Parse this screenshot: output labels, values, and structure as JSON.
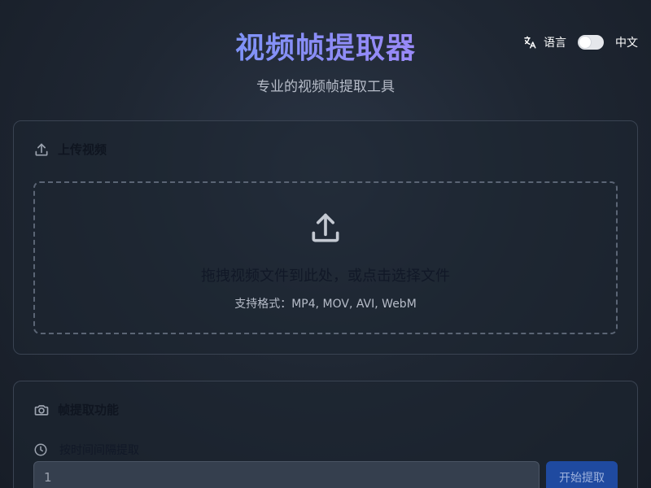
{
  "header": {
    "title": "视频帧提取器",
    "subtitle": "专业的视频帧提取工具"
  },
  "language": {
    "label": "语言",
    "current": "中文",
    "icon": "translate-icon",
    "toggle_on": false
  },
  "upload_card": {
    "title": "上传视频",
    "icon": "upload-icon",
    "dropzone": {
      "icon": "upload-arrow-icon",
      "main_text": "拖拽视频文件到此处，或点击选择文件",
      "formats_text": "支持格式：MP4, MOV, AVI, WebM"
    }
  },
  "extract_card": {
    "title": "帧提取功能",
    "icon": "camera-icon",
    "mode": {
      "label": "按时间间隔提取",
      "icon": "clock-icon"
    },
    "interval_value": "1",
    "start_button": "开始提取"
  },
  "colors": {
    "title_gradient_start": "#60a5fa",
    "title_gradient_end": "#c084fc",
    "primary_button": "#1f4aa0",
    "card_border": "#3a4352"
  }
}
